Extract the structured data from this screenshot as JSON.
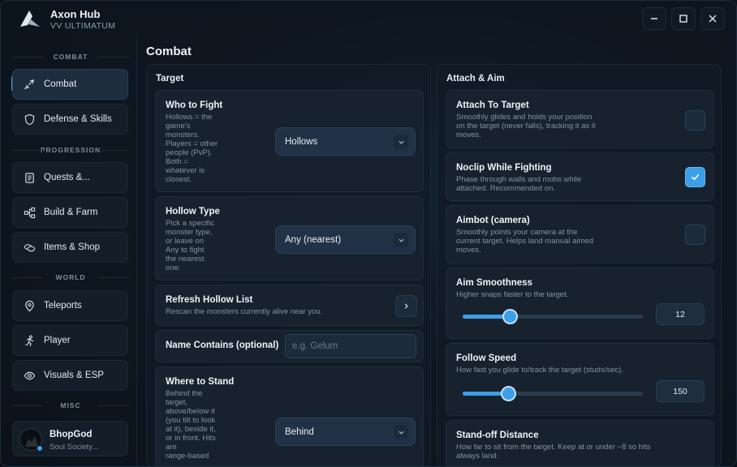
{
  "window": {
    "title": "Axon Hub",
    "subtitle": "VV ULTIMATUM",
    "controls": [
      "minimize",
      "maximize",
      "close"
    ]
  },
  "sidebar": {
    "sections": [
      {
        "label": "COMBAT",
        "items": [
          {
            "label": "Combat",
            "icon": "sword-icon",
            "active": true
          },
          {
            "label": "Defense & Skills",
            "icon": "shield-icon"
          }
        ]
      },
      {
        "label": "PROGRESSION",
        "items": [
          {
            "label": "Quests &...",
            "icon": "scroll-icon"
          },
          {
            "label": "Build & Farm",
            "icon": "nodes-icon"
          },
          {
            "label": "Items & Shop",
            "icon": "coins-icon"
          }
        ]
      },
      {
        "label": "WORLD",
        "items": [
          {
            "label": "Teleports",
            "icon": "map-pin-icon"
          },
          {
            "label": "Player",
            "icon": "running-person-icon"
          },
          {
            "label": "Visuals & ESP",
            "icon": "eye-icon"
          }
        ]
      },
      {
        "label": "MISC",
        "items": []
      }
    ],
    "profile": {
      "name": "BhopGod",
      "subtitle": "Soul Society...",
      "status": "online"
    }
  },
  "main": {
    "title": "Combat",
    "target_panel": {
      "title": "Target",
      "who_to_fight": {
        "title": "Who to Fight",
        "desc": [
          "Hollows = the",
          "game's",
          "monsters.",
          "Players = other",
          "people (PvP).",
          "Both =",
          "whatever is",
          "closest."
        ],
        "value": "Hollows"
      },
      "hollow_type": {
        "title": "Hollow Type",
        "desc": [
          "Pick a specific",
          "monster type,",
          "or leave on",
          "Any to fight",
          "the nearest",
          "one."
        ],
        "value": "Any (nearest)"
      },
      "refresh": {
        "title": "Refresh Hollow List",
        "desc": "Rescan the monsters currently alive near you."
      },
      "name_contains": {
        "title": "Name Contains (optional)",
        "placeholder": "e.g. Gelum",
        "value": ""
      },
      "where_to_stand": {
        "title": "Where to Stand",
        "desc": [
          "Behind the",
          "target,",
          "above/below it",
          "(you tilt to look",
          "at it), beside it,",
          "or in front. Hits",
          "are",
          "range-based"
        ],
        "value": "Behind"
      }
    },
    "attach_panel": {
      "title": "Attach & Aim",
      "attach_to_target": {
        "title": "Attach To Target",
        "desc": [
          "Smoothly glides and holds your position",
          "on the target (never falls), tracking it as it",
          "moves."
        ],
        "checked": false
      },
      "noclip": {
        "title": "Noclip While Fighting",
        "desc": [
          "Phase through walls and mobs while",
          "attached. Recommended on."
        ],
        "checked": true
      },
      "aimbot": {
        "title": "Aimbot (camera)",
        "desc": [
          "Smoothly points your camera at the",
          "current target. Helps land manual aimed",
          "moves."
        ],
        "checked": false
      },
      "aim_smoothness": {
        "title": "Aim Smoothness",
        "desc": "Higher snaps faster to the target.",
        "value": "12",
        "fraction": 0.26
      },
      "follow_speed": {
        "title": "Follow Speed",
        "desc": "How fast you glide to/track the target (studs/sec).",
        "value": "150",
        "fraction": 0.25
      },
      "standoff": {
        "title": "Stand-off Distance",
        "desc": [
          "How far to sit from the target. Keep at or under ~8 so hits",
          "always land."
        ]
      }
    }
  },
  "colors": {
    "accent": "#3c9fe9",
    "background": "#0e1721",
    "card": "#17222e"
  }
}
